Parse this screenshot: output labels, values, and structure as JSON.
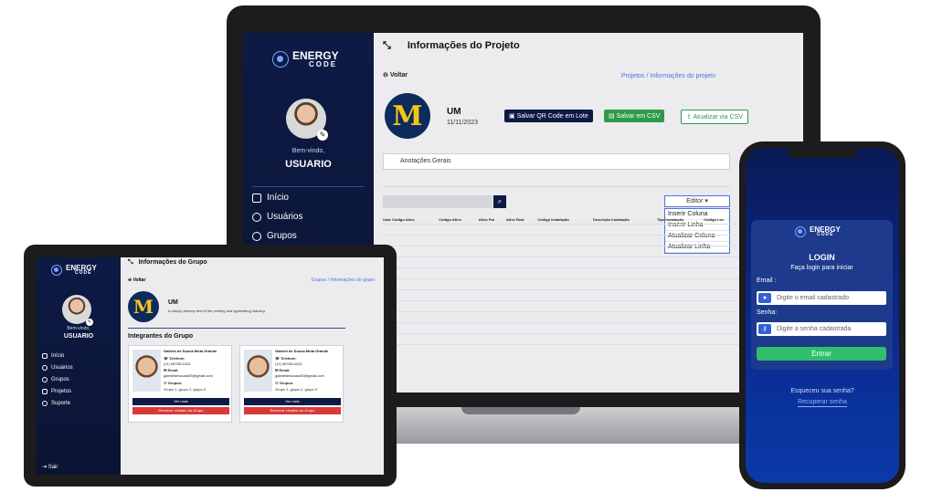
{
  "laptop": {
    "logo_line1": "ENERGY",
    "logo_line2": "CODE",
    "welcome": "Bem-vindo,",
    "user": "USUARIO",
    "nav": [
      "Início",
      "Usuários",
      "Grupos"
    ],
    "header_title": "Informações do Projeto",
    "back": "Voltar",
    "breadcrumb": "Projetos / Informações do projeto",
    "project_name": "UM",
    "project_date": "11/11/2023",
    "btn_qr": "Salvar QR Code em Lote",
    "btn_save_csv": "Salvar em CSV",
    "btn_update_csv": "Atualizar via CSV",
    "notes": "Anotações Gerais",
    "editor": "Editor",
    "editor_menu": [
      "Inserir Coluna",
      "Inserir Linha",
      "Atualizar Coluna",
      "Atualizar Linha"
    ],
    "table_headers": [
      "Usar Código Ativo",
      "Código Ativo",
      "Ativo Pai",
      "Ativo Real",
      "Código Instalação",
      "Descrição Instalação",
      "Tipo Instalação",
      "Código Loc"
    ],
    "table_rows": 12
  },
  "tablet": {
    "logo_line1": "ENERGY",
    "logo_line2": "CODE",
    "welcome": "Bem-vindo,",
    "user": "USUARIO",
    "nav": [
      "Início",
      "Usuários",
      "Grupos",
      "Projetos",
      "Suporte"
    ],
    "sair": "Sair",
    "header_title": "Informações do Grupo",
    "back": "Voltar",
    "breadcrumb": "Grupos / Informações do grupo",
    "group_name": "UM",
    "group_desc": "is simply dummy text of the printing and typesetting industry.",
    "section_title": "Integrantes do Grupo",
    "members": [
      {
        "name": "Gabriel de Sousa Mota Grande",
        "phone_label": "Telefone:",
        "phone": "(11) 98765-5423",
        "email_label": "Email:",
        "email": "gabrieldesousa05@gmail.com",
        "groups_label": "Grupos:",
        "groups": "Grupo 1, grupo 2, grupo 3",
        "view": "Ver mais",
        "remove": "Remover Usuário do Grupo"
      },
      {
        "name": "Gabriel de Sousa Mota Grande",
        "phone_label": "Telefone:",
        "phone": "(11) 98765-5423",
        "email_label": "Email:",
        "email": "gabrieldesousa05@gmail.com",
        "groups_label": "Grupos:",
        "groups": "Grupo 1, grupo 2, grupo 3",
        "view": "Ver mais",
        "remove": "Remover Usuário do Grupo"
      }
    ]
  },
  "phone": {
    "logo_line1": "ENERGY",
    "logo_line2": "CODE",
    "title": "LOGIN",
    "subtitle": "Faça login para iniciar",
    "email_label": "Email :",
    "email_placeholder": "Digite o email cadastrado",
    "password_label": "Senha:",
    "password_placeholder": "Digite a senha cadastrada",
    "enter": "Entrar",
    "forgot": "Esqueceu sua senha?",
    "recover": "Recuperar senha"
  },
  "colors": {
    "navy": "#0d1a45",
    "green": "#2e9a4a",
    "red": "#d83a3a",
    "link": "#4e72d9",
    "michigan_gold": "#f5c518"
  }
}
